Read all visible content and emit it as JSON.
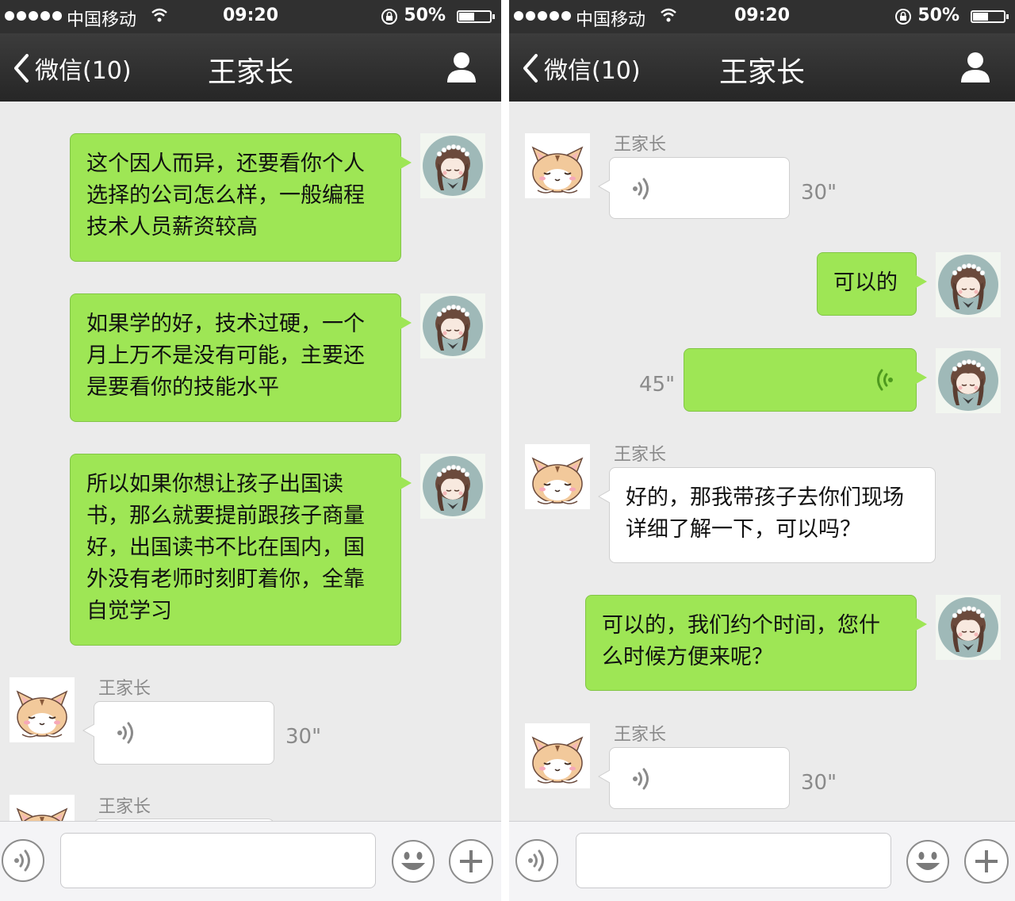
{
  "status_bar": {
    "carrier": "中国移动",
    "time": "09:20",
    "battery": "50%"
  },
  "nav": {
    "back_label": "微信(10)",
    "title": "王家长"
  },
  "left_chat": {
    "messages": [
      {
        "from": "me",
        "text": "这个因人而异，还要看你个人选择的公司怎么样，一般编程技术人员薪资较高"
      },
      {
        "from": "me",
        "text": "如果学的好，技术过硬，一个月上万不是没有可能，主要还是要看你的技能水平"
      },
      {
        "from": "me",
        "text": "所以如果你想让孩子出国读书，那么就要提前跟孩子商量好，出国读书不比在国内，国外没有老师时刻盯着你，全靠自觉学习"
      },
      {
        "from": "them",
        "sender": "王家长",
        "type": "voice",
        "duration": "30\""
      },
      {
        "from": "them",
        "sender": "王家长",
        "type": "voice-partial"
      }
    ]
  },
  "right_chat": {
    "messages": [
      {
        "from": "them",
        "sender": "王家长",
        "type": "voice",
        "duration": "30\""
      },
      {
        "from": "me",
        "text": "可以的"
      },
      {
        "from": "me",
        "type": "voice",
        "duration": "45\""
      },
      {
        "from": "them",
        "sender": "王家长",
        "text": "好的，那我带孩子去你们现场详细了解一下，可以吗？"
      },
      {
        "from": "me",
        "text": "可以的，我们约个时间，您什么时候方便来呢？"
      },
      {
        "from": "them",
        "sender": "王家长",
        "type": "voice",
        "duration": "30\""
      }
    ]
  },
  "colors": {
    "my_bubble": "#9ee655",
    "their_bubble": "#ffffff",
    "nav_bar": "#2e2e2e",
    "chat_bg": "#ebebeb"
  },
  "icons": [
    "back-chevron-icon",
    "person-icon",
    "wifi-icon",
    "lock-rotation-icon",
    "battery-icon",
    "voice-wave-icon",
    "smiley-icon",
    "plus-icon"
  ]
}
